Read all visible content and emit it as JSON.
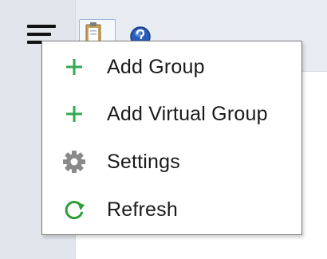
{
  "toolbar": {
    "menu_icon": "hamburger-menu-icon",
    "clipboard_icon": "clipboard-icon",
    "help_icon": "help-icon"
  },
  "menu": {
    "items": [
      {
        "label": "Add Group",
        "icon": "plus-icon"
      },
      {
        "label": "Add Virtual Group",
        "icon": "plus-icon"
      },
      {
        "label": "Settings",
        "icon": "gear-icon"
      },
      {
        "label": "Refresh",
        "icon": "refresh-icon"
      }
    ]
  },
  "colors": {
    "plus": "#33a853",
    "refresh": "#2f9e3a",
    "gear": "#8a8a8a",
    "help_blue": "#2a5db8",
    "menu_border": "#7a7a7a"
  }
}
